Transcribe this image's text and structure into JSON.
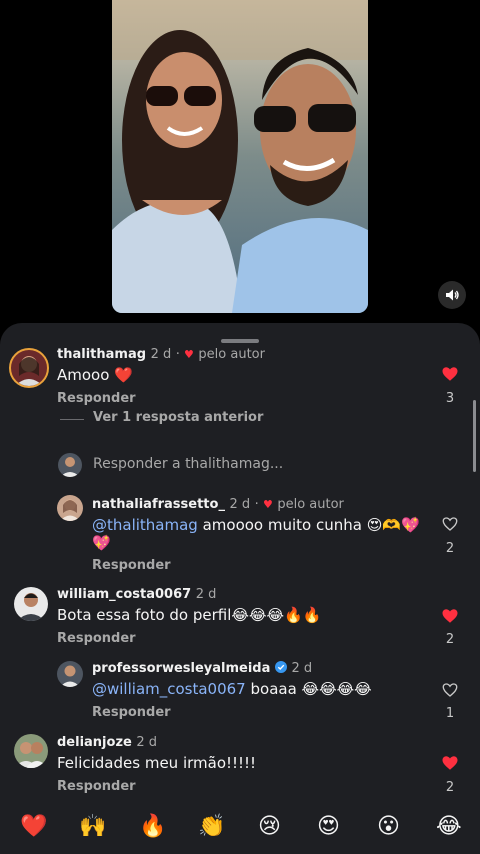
{
  "comments": [
    {
      "username": "thalithamag",
      "time": "2 d",
      "liked_by_author": "pelo autor",
      "text": "Amooo ❤️",
      "reply_label": "Responder",
      "like_count": "3",
      "liked": true
    },
    {
      "username": "nathaliafrassetto_",
      "time": "2 d",
      "liked_by_author": "pelo autor",
      "mention": "@thalithamag",
      "text": " amoooo muito cunha 😍🫶💖",
      "text_line2": "💖",
      "reply_label": "Responder",
      "like_count": "2",
      "liked": false
    },
    {
      "username": "william_costa0067",
      "time": "2 d",
      "text": "Bota essa foto do perfil😂😂😂🔥🔥",
      "reply_label": "Responder",
      "like_count": "2",
      "liked": true
    },
    {
      "username": "professorwesleyalmeida",
      "time": "2 d",
      "mention": "@william_costa0067",
      "text": " boaaa 😂😂😂😂",
      "reply_label": "Responder",
      "like_count": "1",
      "liked": false
    },
    {
      "username": "delianjoze",
      "time": "2 d",
      "text": "Felicidades meu irmão!!!!!",
      "reply_label": "Responder",
      "like_count": "2",
      "liked": true
    }
  ],
  "thread": {
    "view_previous": "Ver 1 resposta anterior",
    "reply_placeholder": "Responder a thalithamag..."
  },
  "emoji_bar": [
    "❤️",
    "🙌",
    "🔥",
    "👏",
    "😢",
    "😍",
    "😮",
    "😂"
  ],
  "colors": {
    "like_red": "#ff3040",
    "mention_blue": "#8ab4f8",
    "sheet_bg": "#1e1f23",
    "verified_blue": "#3797f0"
  }
}
